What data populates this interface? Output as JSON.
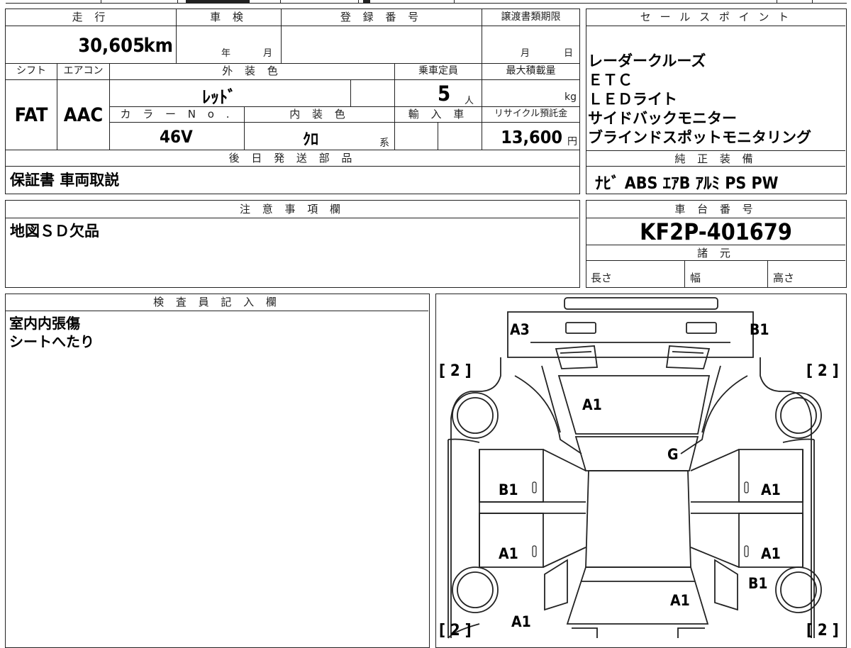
{
  "headers": {
    "mileage": "走 行",
    "inspection": "車 検",
    "registration": "登 録 番 号",
    "transfer_deadline": "譲渡書類期限",
    "sales_points": "セ ー ル ス ポ イ ン ト",
    "shift": "シフト",
    "aircon": "エアコン",
    "exterior_color": "外 装 色",
    "capacity": "乗車定員",
    "max_load": "最大積載量",
    "color_no": "カ ラ ー N o .",
    "interior_color": "内 装 色",
    "import": "輸 入 車",
    "recycle": "リサイクル預託金",
    "later_parts": "後 日 発 送 部 品",
    "genuine_equipment": "純 正 装 備",
    "notes": "注 意 事 項 欄",
    "chassis_number": "車 台 番 号",
    "specs": "諸 元",
    "inspector": "検 査 員 記 入 欄"
  },
  "values": {
    "mileage": "30,605",
    "mileage_unit": "km",
    "year_label": "年",
    "month_label": "月",
    "deadline_month": "月",
    "deadline_day": "日",
    "shift": "FAT",
    "aircon": "AAC",
    "exterior_color": "ﾚｯﾄﾞ",
    "capacity": "5",
    "capacity_unit": "人",
    "max_load_unit": "kg",
    "color_no": "46V",
    "interior_color": "ｸﾛ",
    "interior_suffix": "系",
    "recycle": "13,600",
    "recycle_unit": "円",
    "later_parts": "保証書 車両取説",
    "genuine_equipment": "ﾅﾋﾞ ABS ｴｱB ｱﾙﾐ PS PW",
    "notes": "地図ＳＤ欠品",
    "chassis_number": "KF2P-401679",
    "length_label": "長さ",
    "width_label": "幅",
    "height_label": "高さ"
  },
  "sales_points": [
    "レーダークルーズ",
    "ＥＴＣ",
    "ＬＥＤライト",
    "サイドバックモニター",
    "ブラインドスポットモニタリング"
  ],
  "inspector_notes": [
    "室内内張傷",
    "シートへたり"
  ],
  "diagram": {
    "tire_marks": [
      "[ 2 ]",
      "[ 2 ]",
      "[ 2 ]",
      "[ 2 ]"
    ],
    "damage_labels": {
      "front_left_corner": "A3",
      "front_right_corner": "B1",
      "hood": "A1",
      "windshield": "G",
      "front_left_door": "B1",
      "front_right_door": "A1",
      "rear_left_door": "A1",
      "rear_right_door": "A1",
      "rear_right_fender": "B1",
      "trunk": "A1",
      "rear_left": "A1"
    },
    "zero_mark": "0"
  }
}
